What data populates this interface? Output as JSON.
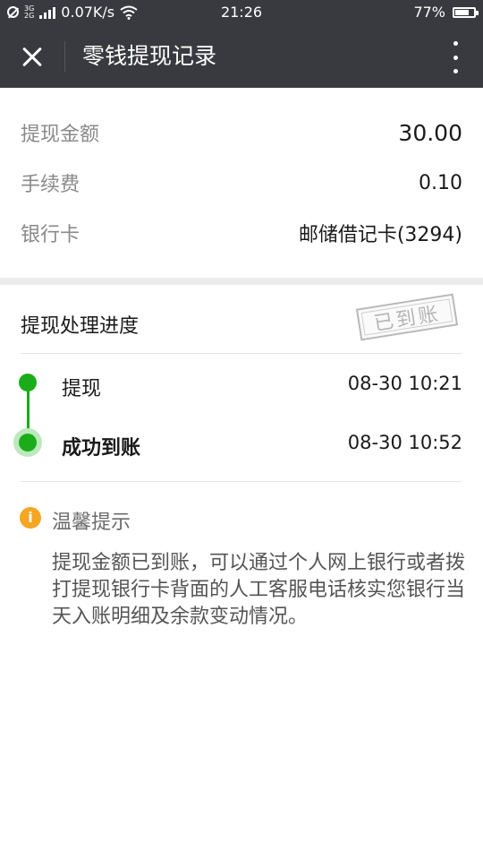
{
  "status_bar": {
    "network_label": "0.07K/s",
    "time": "21:26",
    "battery": "77%",
    "battery_level": 0.77,
    "hd_top": "3G",
    "hd_bottom": "2G"
  },
  "nav": {
    "title": "零钱提现记录",
    "close_icon": "close-icon",
    "more_icon": "more-vertical-icon"
  },
  "details": {
    "amount_label": "提现金额",
    "amount_value": "30.00",
    "fee_label": "手续费",
    "fee_value": "0.10",
    "card_label": "银行卡",
    "card_value": "邮储借记卡(3294)"
  },
  "progress": {
    "title": "提现处理进度",
    "stamp": "已到账",
    "steps": [
      {
        "label": "提现",
        "time": "08-30 10:21"
      },
      {
        "label": "成功到账",
        "time": "08-30 10:52"
      }
    ]
  },
  "tips": {
    "icon": "info-icon",
    "icon_glyph": "i",
    "title": "温馨提示",
    "body": "提现金额已到账，可以通过个人网上银行或者拨打提现银行卡背面的人工客服电话核实您银行当天入账明细及余款变动情况。"
  },
  "colors": {
    "header_bg": "#393a3f",
    "accent_green": "#1aad19",
    "tip_orange": "#f5a623"
  }
}
